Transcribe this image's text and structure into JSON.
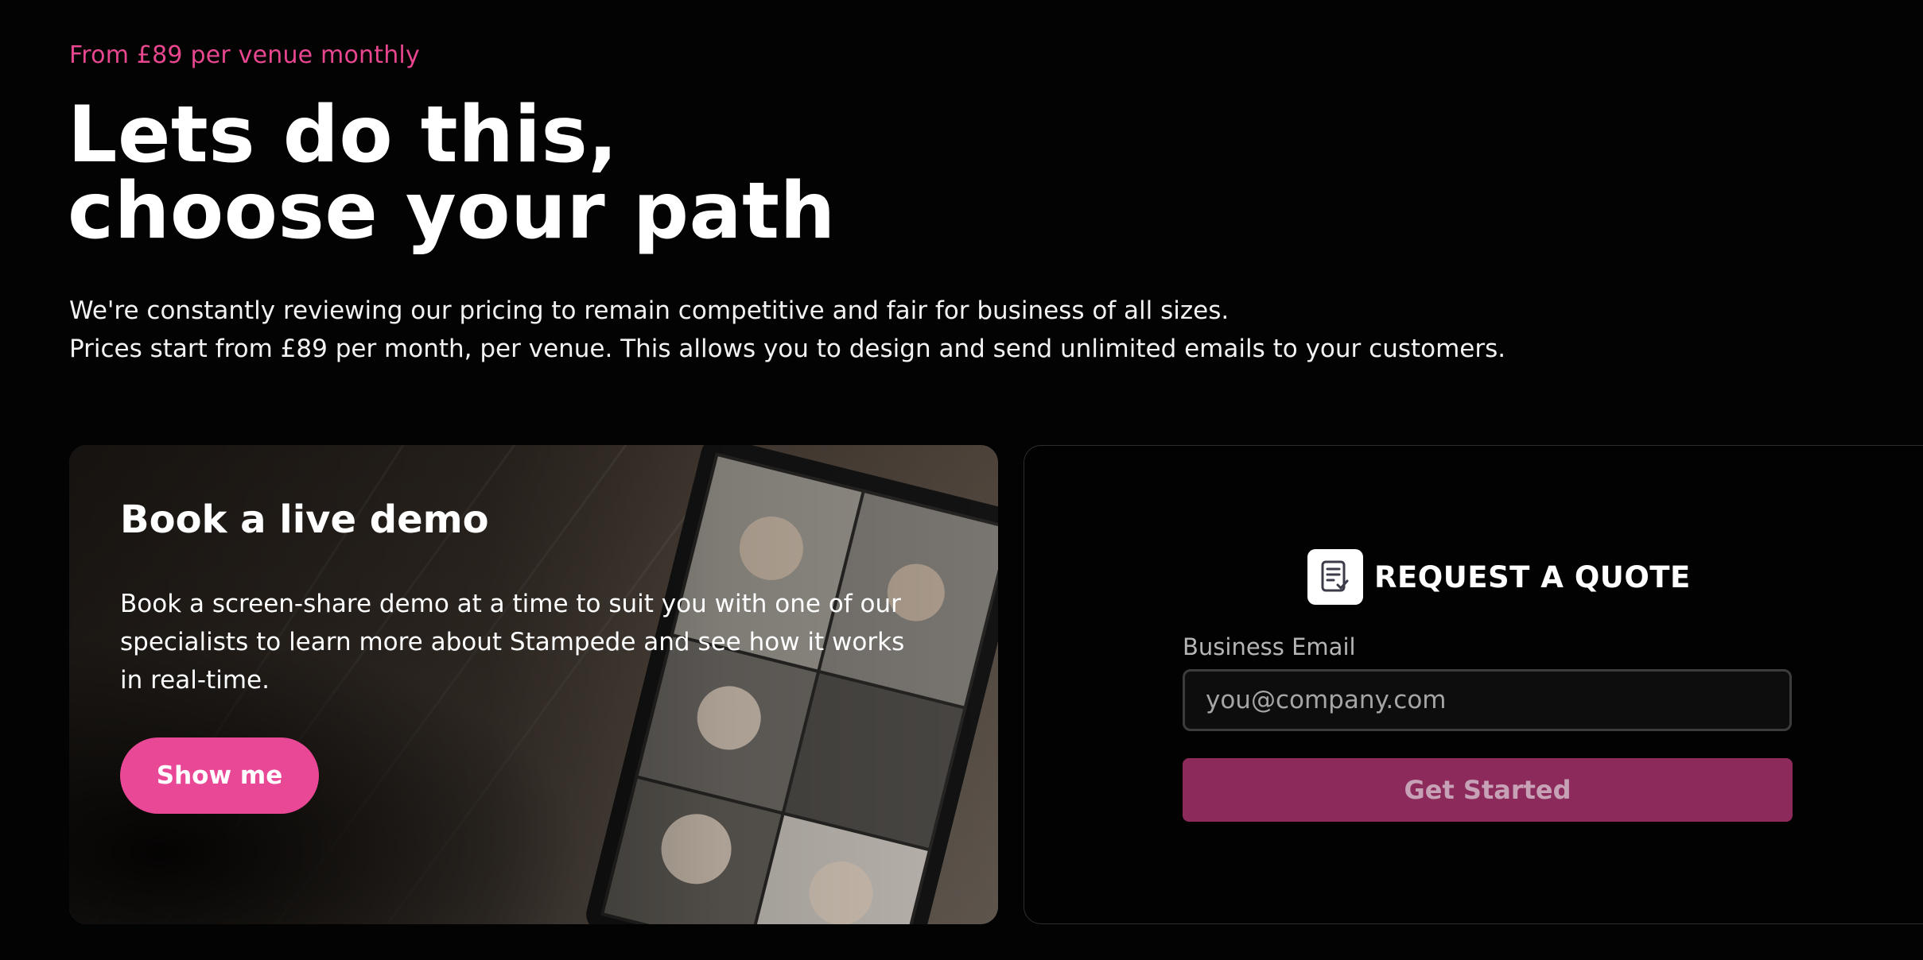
{
  "hero": {
    "eyebrow": "From £89 per venue monthly",
    "headline_line1": "Lets do this,",
    "headline_line2": "choose your path",
    "intro_line1": "We're constantly reviewing our pricing to remain competitive and fair for business of all sizes.",
    "intro_line2": "Prices start from £89 per month, per venue. This allows you to design and send unlimited emails to your customers."
  },
  "demo_card": {
    "title": "Book a live demo",
    "text_line1": "Book a screen-share demo at a time to suit you with one of our",
    "text_line2": "specialists to learn more about Stampede and see how it works",
    "text_line3": "in real-time.",
    "button_label": "Show me",
    "background_icon": "video-call-photo"
  },
  "quote_card": {
    "icon": "document-check-icon",
    "title": "REQUEST A QUOTE",
    "email_label": "Business Email",
    "email_placeholder": "you@company.com",
    "email_value": "",
    "submit_label": "Get Started"
  },
  "colors": {
    "accent_pink": "#e94896",
    "button_disabled": "#8c2a5c",
    "background": "#030303"
  }
}
